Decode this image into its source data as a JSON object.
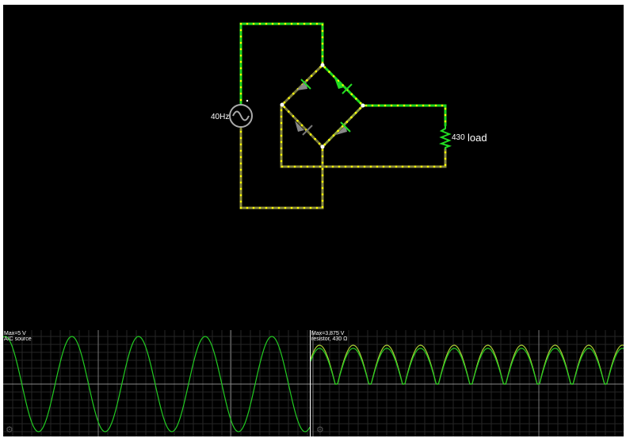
{
  "circuit": {
    "source_label": "40Hz",
    "resistor_value": "430",
    "resistor_label": "load"
  },
  "scopes": [
    {
      "max_label": "Max=5 V",
      "name_label": "A/C source",
      "settings_icon": "gear-icon"
    },
    {
      "max_label": "Max=3.875 V",
      "name_label": "resistor, 430 Ω",
      "settings_icon": "gear-icon"
    }
  ],
  "colors": {
    "background": "#000000",
    "wire_high": "#22dd22",
    "wire_low": "#aaaa33",
    "current_dot": "#ffff00",
    "trace": "#22cc22",
    "trace_secondary": "#aacc33",
    "grid": "#333333"
  },
  "scope_data": {
    "scope1_cycles_visible": 4.6,
    "scope2_humps_visible": 9
  }
}
